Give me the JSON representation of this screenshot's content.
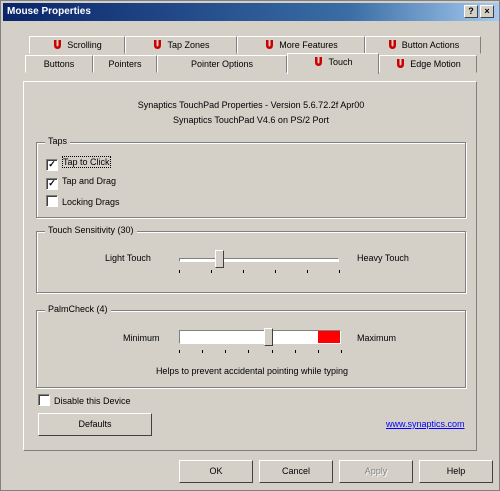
{
  "window": {
    "title": "Mouse Properties"
  },
  "titlebar_buttons": {
    "help": "?",
    "close": "×"
  },
  "tabs_row1": [
    {
      "label": "Scrolling",
      "icon": "synaptics-icon"
    },
    {
      "label": "Tap Zones",
      "icon": "synaptics-icon"
    },
    {
      "label": "More Features",
      "icon": "synaptics-icon"
    },
    {
      "label": "Button Actions",
      "icon": "synaptics-icon"
    }
  ],
  "tabs_row2": [
    {
      "label": "Buttons"
    },
    {
      "label": "Pointers"
    },
    {
      "label": "Pointer Options"
    },
    {
      "label": "Touch",
      "icon": "synaptics-icon",
      "active": true
    },
    {
      "label": "Edge Motion",
      "icon": "synaptics-icon"
    }
  ],
  "info": {
    "line1": "Synaptics TouchPad Properties - Version 5.6.72.2f Apr00",
    "line2": "Synaptics TouchPad V4.6 on PS/2 Port"
  },
  "taps": {
    "legend": "Taps",
    "items": [
      {
        "label": "Tap to Click",
        "checked": true,
        "mark": "✓"
      },
      {
        "label": "Tap and Drag",
        "checked": true,
        "mark": "✓"
      },
      {
        "label": "Locking Drags",
        "checked": false,
        "mark": ""
      }
    ]
  },
  "touch_sensitivity": {
    "legend": "Touch Sensitivity (30)",
    "left_label": "Light Touch",
    "right_label": "Heavy Touch",
    "level": 0.25
  },
  "palmcheck": {
    "legend": "PalmCheck (4)",
    "left_label": "Minimum",
    "right_label": "Maximum",
    "level": 0.55,
    "caption": "Helps to prevent accidental pointing while typing",
    "danger_color": "#ff0000"
  },
  "disable_device": {
    "label": "Disable this Device",
    "checked": false,
    "mark": ""
  },
  "defaults_button": "Defaults",
  "synaptics_link": "www.synaptics.com",
  "footer": {
    "ok": "OK",
    "cancel": "Cancel",
    "apply": "Apply",
    "help": "Help"
  },
  "colors": {
    "title_start": "#0a246a",
    "title_end": "#a6caf0",
    "face": "#d4d0c8",
    "icon_red": "#cc0000"
  }
}
